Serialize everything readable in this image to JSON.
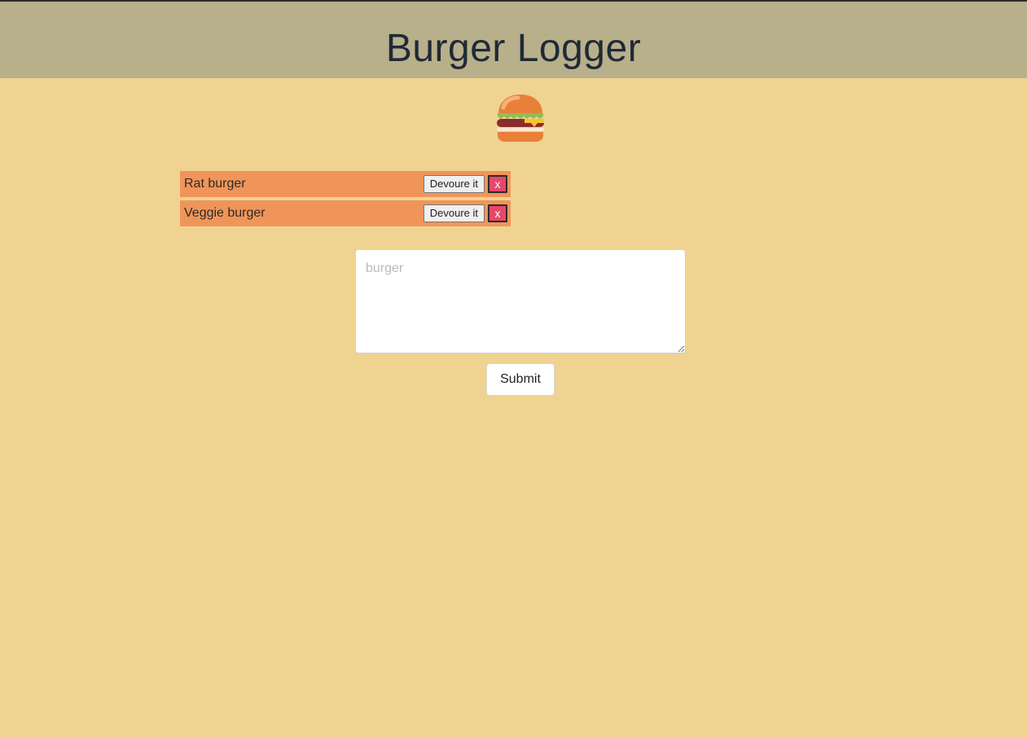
{
  "header": {
    "title": "Burger Logger"
  },
  "logo": {
    "icon": "burger-icon"
  },
  "burgers": [
    {
      "name": "Rat burger",
      "devour_label": "Devoure it",
      "delete_label": "x"
    },
    {
      "name": "Veggie burger",
      "devour_label": "Devoure it",
      "delete_label": "x"
    }
  ],
  "form": {
    "placeholder": "burger",
    "value": "",
    "submit_label": "Submit"
  },
  "colors": {
    "page_background": "#f0d391",
    "header_background": "#b8b08b",
    "row_background": "#f0955a",
    "delete_button": "#e8476a"
  }
}
